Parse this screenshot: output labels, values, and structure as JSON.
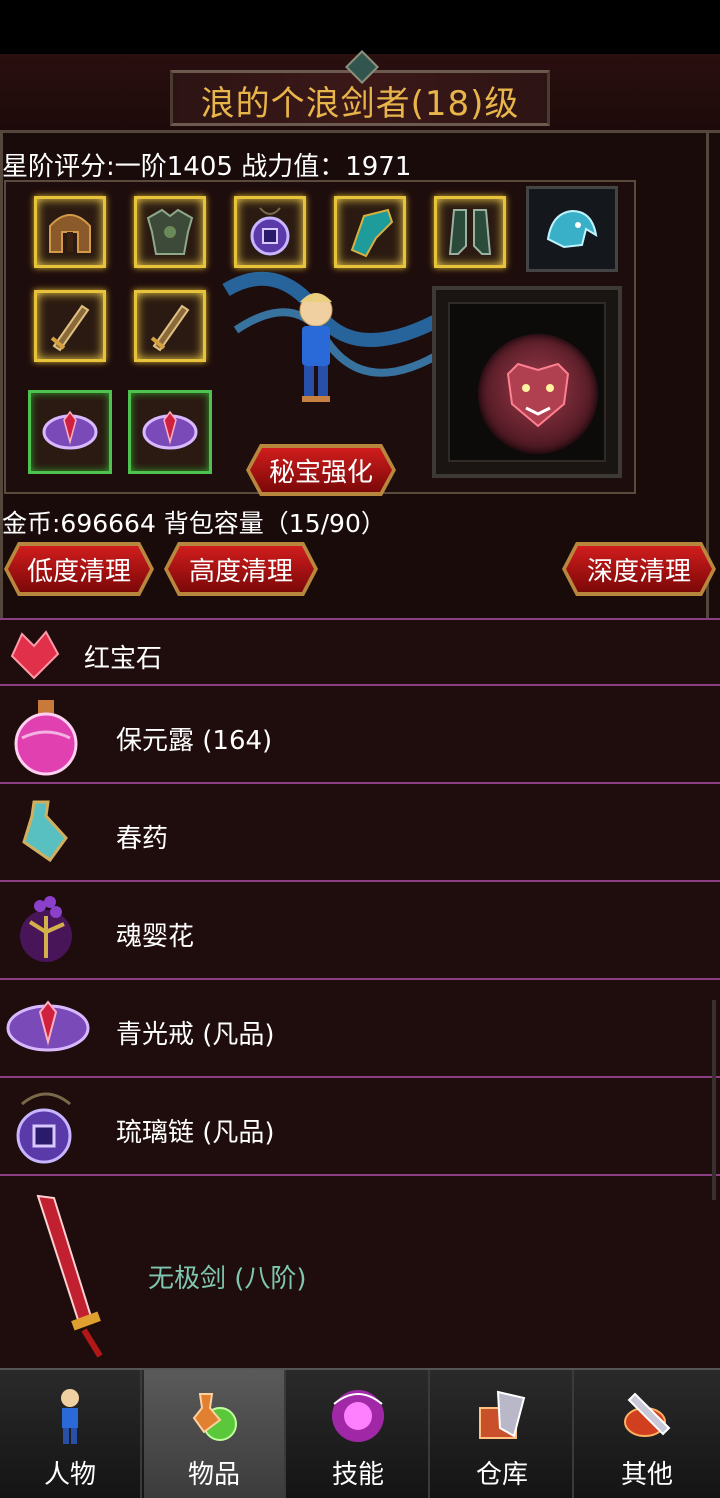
{
  "header": {
    "title": "浪的个浪剑者(18)级"
  },
  "stats": {
    "line": "星阶评分:一阶1405 战力值：1971"
  },
  "equipment": {
    "enhance_button": "秘宝强化",
    "slots": [
      "helmet-icon",
      "armor-icon",
      "amulet-icon",
      "bracer-icon",
      "boots-icon",
      "spirit-beast-icon",
      "sword-icon",
      "sword-icon",
      "ring-icon",
      "ring-icon"
    ]
  },
  "inventory": {
    "gold_line": "金币:696664 背包容量（15/90）",
    "buttons": {
      "low": "低度清理",
      "high": "高度清理",
      "deep": "深度清理"
    },
    "items": [
      {
        "icon": "ruby-icon",
        "label": "红宝石"
      },
      {
        "icon": "potion-icon",
        "label": "保元露 (164)"
      },
      {
        "icon": "bottle-icon",
        "label": "春药"
      },
      {
        "icon": "flower-icon",
        "label": "魂婴花"
      },
      {
        "icon": "ring-icon",
        "label": "青光戒 (凡品)"
      },
      {
        "icon": "amulet-icon",
        "label": "琉璃链 (凡品)"
      },
      {
        "icon": "sword-icon",
        "label": "无极剑 (八阶)",
        "color": "#7fc6b0"
      }
    ]
  },
  "tabs": [
    {
      "label": "人物",
      "icon": "character-icon"
    },
    {
      "label": "物品",
      "icon": "items-icon",
      "active": true
    },
    {
      "label": "技能",
      "icon": "skills-icon"
    },
    {
      "label": "仓库",
      "icon": "warehouse-icon"
    },
    {
      "label": "其他",
      "icon": "other-icon"
    }
  ]
}
